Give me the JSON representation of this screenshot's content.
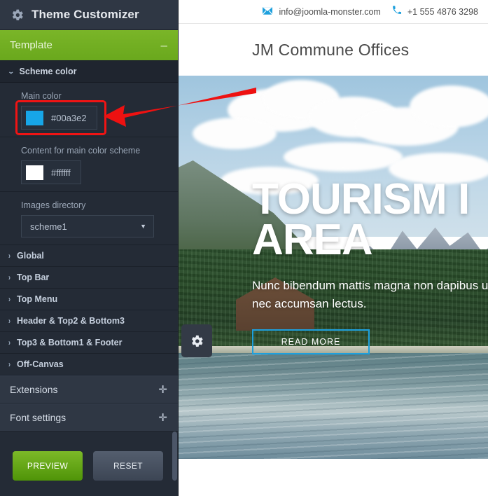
{
  "sidebar": {
    "header": {
      "title": "Theme Customizer",
      "icon": "gear-icon"
    },
    "template_section": {
      "label": "Template",
      "toggle_sign": "–"
    },
    "scheme_color": {
      "label": "Scheme color",
      "caret": "⌄"
    },
    "fields": {
      "main_color": {
        "label": "Main color",
        "value": "#00a3e2",
        "swatch": "#17a6e8"
      },
      "content_color": {
        "label": "Content for main color scheme",
        "value": "#ffffff",
        "swatch": "#ffffff"
      },
      "images_dir": {
        "label": "Images directory",
        "value": "scheme1",
        "arrow": "▼"
      }
    },
    "accordion_rows": [
      {
        "label": "Global",
        "caret": "›"
      },
      {
        "label": "Top Bar",
        "caret": "›"
      },
      {
        "label": "Top Menu",
        "caret": "›"
      },
      {
        "label": "Header & Top2 & Bottom3",
        "caret": "›"
      },
      {
        "label": "Top3 & Bottom1 & Footer",
        "caret": "›"
      },
      {
        "label": "Off-Canvas",
        "caret": "›"
      }
    ],
    "major_rows": [
      {
        "label": "Extensions",
        "sign": "✛"
      },
      {
        "label": "Font settings",
        "sign": "✛"
      }
    ],
    "buttons": {
      "preview": "PREVIEW",
      "reset": "RESET"
    }
  },
  "preview": {
    "topbar": {
      "email": "info@joomla-monster.com",
      "email_icon": "envelope-icon",
      "phone": "+1 555 4876 3298",
      "phone_icon": "phone-icon",
      "icon_color": "#1ea0dd"
    },
    "site_title": "JM Commune Offices",
    "hero": {
      "title": "TOURISM I",
      "title_line2": "AREA",
      "subtitle": "Nunc bibendum mattis magna non dapibus ultricies, nec accumsan lectus.",
      "read_more": "READ MORE",
      "read_more_border": "#1ea0dd",
      "gear_icon": "gear-icon"
    }
  },
  "annotation": {
    "arrow_color": "#ee1111",
    "highlight_color": "#f01414",
    "target": "main-color-field"
  }
}
